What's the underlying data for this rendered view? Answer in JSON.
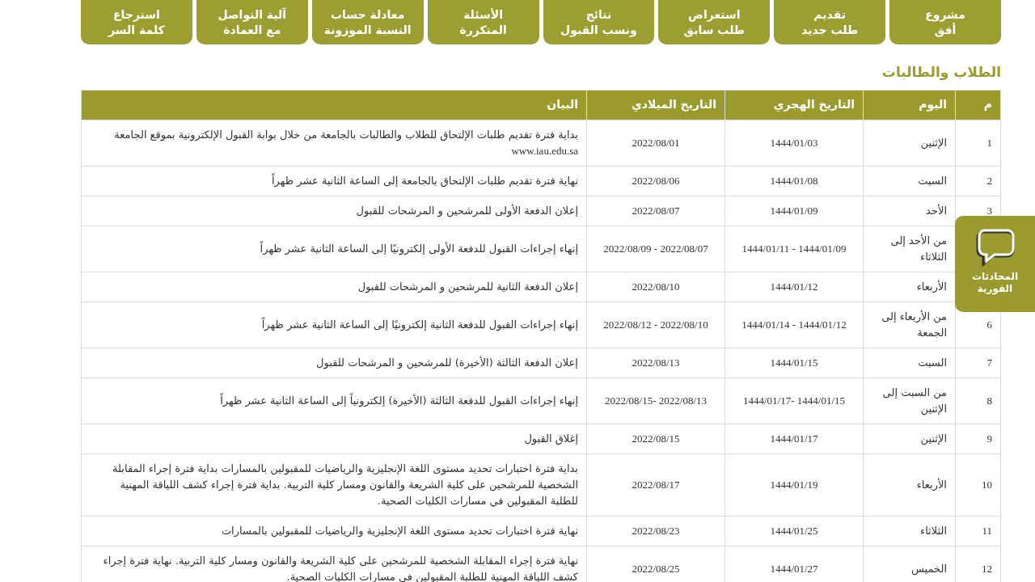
{
  "nav_buttons": [
    {
      "label": "مشروع\nأفق"
    },
    {
      "label": "تقديم\nطلب جديد"
    },
    {
      "label": "استعراض\nطلب سابق"
    },
    {
      "label": "نتائج\nونسب القبول"
    },
    {
      "label": "الأسئلة\nالمتكررة"
    },
    {
      "label": "معادلة حساب\nالنسبة الموزونة"
    },
    {
      "label": "آلية التواصل\nمع العمادة"
    },
    {
      "label": "استرجاع\nكلمة السر"
    }
  ],
  "section_title": "الطلاب والطالبات",
  "table": {
    "columns": [
      "م",
      "اليوم",
      "التاريخ الهجري",
      "التاريخ الميلادي",
      "البيان"
    ],
    "rows": [
      {
        "num": "1",
        "day": "الإثنين",
        "hijri": "1444/01/03",
        "gregorian": "2022/08/01",
        "statement": "بداية فترة تقديم طلبات الإلتحاق للطلاب والطالبات بالجامعة من خلال بوابة القبول الإلكترونية بموقع الجامعة",
        "link": "www.iau.edu.sa"
      },
      {
        "num": "2",
        "day": "السبت",
        "hijri": "1444/01/08",
        "gregorian": "2022/08/06",
        "statement": "نهاية فترة تقديم طلبات الإلتحاق بالجامعة إلى الساعة الثانية عشر ظهراً"
      },
      {
        "num": "3",
        "day": "الأحد",
        "hijri": "1444/01/09",
        "gregorian": "2022/08/07",
        "statement": "إعلان الدفعة الأولى للمرشحين و المرشحات للقبول"
      },
      {
        "day": "من الأحد إلى الثلاثاء",
        "hijri": "1444/01/09 - 1444/01/11",
        "gregorian": "2022/08/07 - 2022/08/09",
        "statement": "إنهاء إجراءات القبول للدفعة الأولى إلكترونيًا إلى الساعة الثانية عشر ظهراً"
      },
      {
        "day": "الأربعاء",
        "hijri": "1444/01/12",
        "gregorian": "2022/08/10",
        "statement": "إعلان الدفعة الثانية للمرشحين و المرشحات للقبول"
      },
      {
        "num": "6",
        "day": "من الأربعاء إلى الجمعة",
        "hijri": "1444/01/12 - 1444/01/14",
        "gregorian": "2022/08/10 - 2022/08/12",
        "statement": "إنهاء إجراءات القبول للدفعة الثانية إلكترونيًا إلى الساعة الثانية عشر ظهراً"
      },
      {
        "num": "7",
        "day": "السبت",
        "hijri": "1444/01/15",
        "gregorian": "2022/08/13",
        "statement": "إعلان الدفعة الثالثة (الأخيرة) للمرشحين و المرشحات للقبول"
      },
      {
        "num": "8",
        "day": "من السبت إلى الإثنين",
        "hijri": "1444/01/15 -1444/01/17",
        "gregorian": "2022/08/13 -2022/08/15",
        "statement": "إنهاء إجراءات القبول للدفعة الثالثة (الأخيرة) إلكترونياً إلى الساعة الثانية عشر ظهراً"
      },
      {
        "num": "9",
        "day": "الإثنين",
        "hijri": "1444/01/17",
        "gregorian": "2022/08/15",
        "statement": "إغلاق القبول"
      },
      {
        "num": "10",
        "day": "الأربعاء",
        "hijri": "1444/01/19",
        "gregorian": "2022/08/17",
        "statement": "بداية فترة اختبارات تحديد مستوى اللغة الإنجليزية والرياضيات للمقبولين بالمسارات بداية فترة إجراء المقابلة الشخصية للمرشحين على كلية الشريعة والقانون ومسار كلية التربية. بداية فترة إجراء كشف اللياقة المهنية للطلبة المقبولين في مسارات الكليات الصحية."
      },
      {
        "num": "11",
        "day": "الثلاثاء",
        "hijri": "1444/01/25",
        "gregorian": "2022/08/23",
        "statement": "نهاية فترة اختبارات تحديد مستوى اللغة الإنجليزية والرياضيات للمقبولين بالمسارات"
      },
      {
        "num": "12",
        "day": "الخميس",
        "hijri": "1444/01/27",
        "gregorian": "2022/08/25",
        "statement": "نهاية فترة إجراء المقابلة الشخصية للمرشحين على كلية الشريعة والقانون ومسار كلية التربية. نهاية فترة إجراء كشف اللياقة المهنية للطلبة المقبولين في مسارات الكليات الصحية."
      }
    ]
  },
  "chat_widget": {
    "label": "المحادثات\nالفورية"
  }
}
